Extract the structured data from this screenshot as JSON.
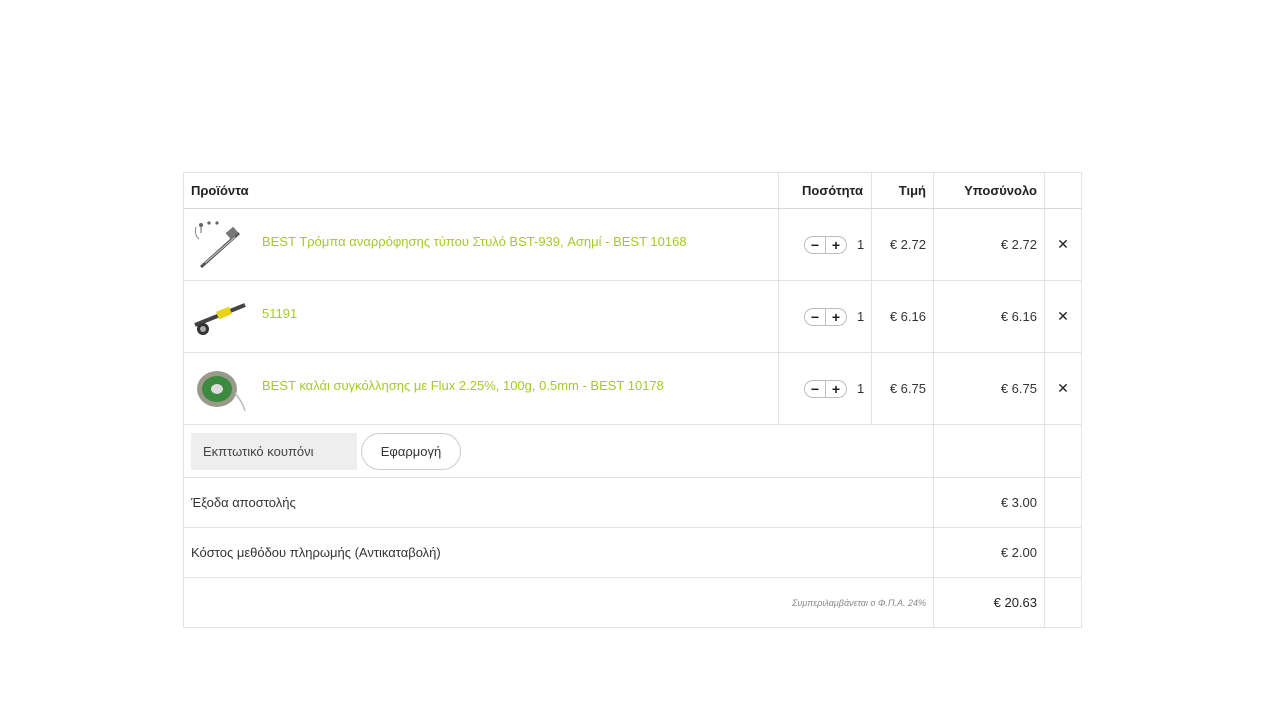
{
  "cart": {
    "headers": {
      "products": "Προϊόντα",
      "quantity": "Ποσότητα",
      "price": "Τιμή",
      "subtotal": "Υποσύνολο"
    },
    "items": [
      {
        "name": "BEST Τρόμπα αναρρόφησης τύπου Στυλό BST-939, Ασημί - BEST 10168",
        "quantity": "1",
        "price": "€ 2.72",
        "subtotal": "€ 2.72"
      },
      {
        "name": "51191",
        "quantity": "1",
        "price": "€ 6.16",
        "subtotal": "€ 6.16"
      },
      {
        "name": "BEST καλάι συγκόλλησης με Flux 2.25%, 100g, 0.5mm - BEST 10178",
        "quantity": "1",
        "price": "€ 6.75",
        "subtotal": "€ 6.75"
      }
    ],
    "qty_minus": "−",
    "qty_plus": "+",
    "remove_symbol": "✕",
    "coupon": {
      "placeholder": "Εκπτωτικό κουπόνι",
      "apply_label": "Εφαρμογή"
    },
    "shipping": {
      "label": "Έξοδα αποστολής",
      "value": "€ 3.00"
    },
    "payment_fee": {
      "label": "Κόστος μεθόδου πληρωμής (Αντικαταβολή)",
      "value": "€ 2.00"
    },
    "total": {
      "vat_note": "Συμπεριλαμβάνεται ο Φ.Π.Α. 24%",
      "value": "€ 20.63"
    },
    "link_color": "#a5c92a"
  }
}
